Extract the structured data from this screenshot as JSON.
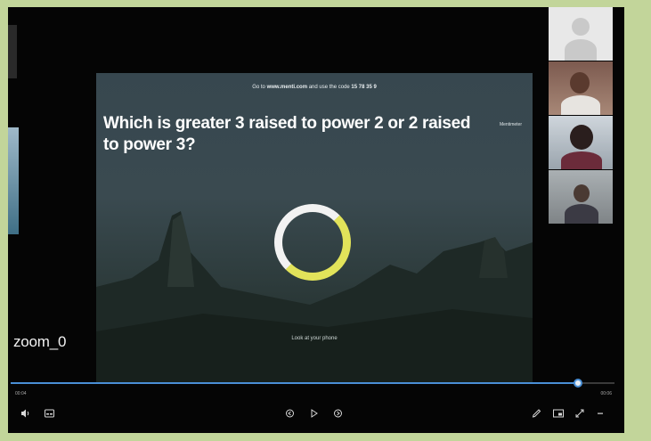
{
  "slide": {
    "banner_prefix": "Go to",
    "banner_site": "www.menti.com",
    "banner_middle": "and use the code",
    "banner_code": "15 78 35 9",
    "question": "Which is greater 3 raised to power 2 or 2 raised to power 3?",
    "badge": "Mentimeter",
    "caption": "Look at your phone"
  },
  "overlay": {
    "participant_name": "zoom_0"
  },
  "player": {
    "time_current": "00:04",
    "time_total": "00:06",
    "progress_fraction": 0.94
  },
  "colors": {
    "background_frame": "#c2d59a",
    "ring_white": "#f2f2f2",
    "ring_yellow": "#e2e35a",
    "progress_blue": "#4a8fd6"
  },
  "icons": {
    "volume": "volume-icon",
    "subtitles": "subtitles-icon",
    "previous": "previous-icon",
    "play": "play-icon",
    "next": "next-icon",
    "pencil": "pencil-icon",
    "screen": "screen-icon",
    "fullscreen": "fullscreen-icon",
    "more": "more-icon"
  }
}
